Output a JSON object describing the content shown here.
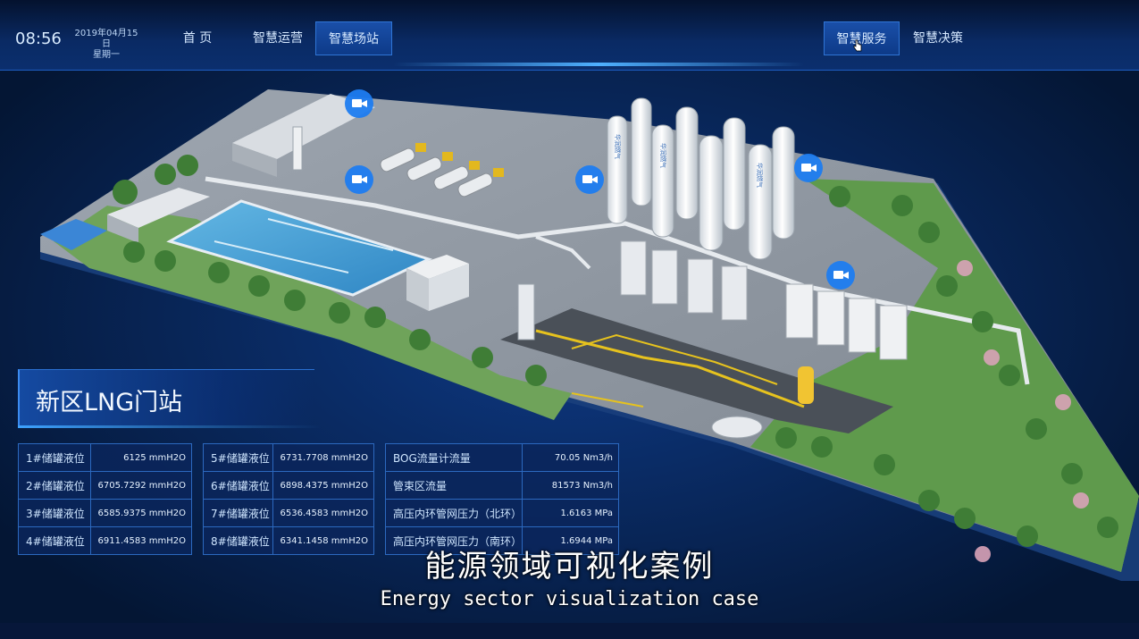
{
  "header": {
    "time": "08:56",
    "date": "2019年04月15日",
    "weekday": "星期一",
    "nav": [
      {
        "label": "首 页"
      },
      {
        "label": "智慧运营"
      },
      {
        "label": "智慧场站"
      },
      {
        "label": "智慧服务"
      },
      {
        "label": "智慧决策"
      }
    ],
    "active_tabs": [
      "智慧场站",
      "智慧服务"
    ]
  },
  "panel": {
    "title": "新区LNG门站",
    "table1": [
      {
        "label": "1#储罐液位",
        "value": "6125 mmH2O"
      },
      {
        "label": "2#储罐液位",
        "value": "6705.7292 mmH2O"
      },
      {
        "label": "3#储罐液位",
        "value": "6585.9375 mmH2O"
      },
      {
        "label": "4#储罐液位",
        "value": "6911.4583 mmH2O"
      }
    ],
    "table2": [
      {
        "label": "5#储罐液位",
        "value": "6731.7708 mmH2O"
      },
      {
        "label": "6#储罐液位",
        "value": "6898.4375 mmH2O"
      },
      {
        "label": "7#储罐液位",
        "value": "6536.4583 mmH2O"
      },
      {
        "label": "8#储罐液位",
        "value": "6341.1458 mmH2O"
      }
    ],
    "table3": [
      {
        "label": "BOG流量计流量",
        "value": "70.05 Nm3/h"
      },
      {
        "label": "管束区流量",
        "value": "81573 Nm3/h"
      },
      {
        "label": "高压内环管网压力（北环）",
        "value": "1.6163 MPa"
      },
      {
        "label": "高压内环管网压力（南环）",
        "value": "1.6944 MPa"
      }
    ]
  },
  "tanks": {
    "label": "华润燃气"
  },
  "caption": {
    "cn": "能源领域可视化案例",
    "en": "Energy sector visualization case"
  },
  "icons": [
    "camera-icon",
    "cursor-hand-icon"
  ],
  "colors": {
    "background": "#051a3e",
    "accent": "#3c8cf0",
    "camera": "#1e7cf0"
  }
}
